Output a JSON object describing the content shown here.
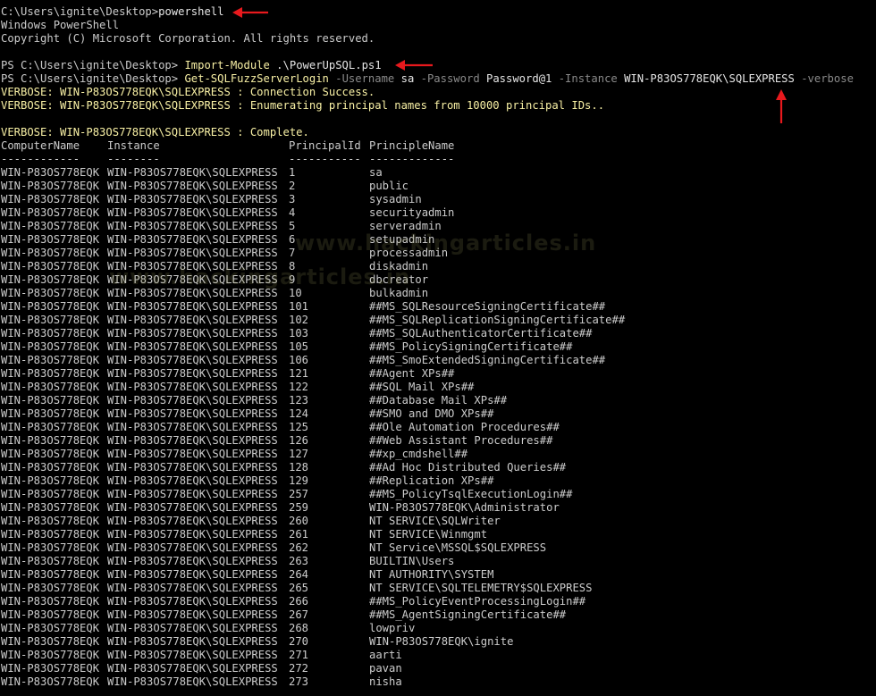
{
  "terminal": {
    "line1_prompt": "C:\\Users\\ignite\\Desktop>",
    "line1_cmd": "powershell",
    "line2": "Windows PowerShell",
    "line3": "Copyright (C) Microsoft Corporation. All rights reserved.",
    "line5_prompt": "PS C:\\Users\\ignite\\Desktop> ",
    "line5_cmd": "Import-Module",
    "line5_arg": " .\\PowerUpSQL.ps1",
    "line6_prompt": "PS C:\\Users\\ignite\\Desktop> ",
    "line6_cmd": "Get-SQLFuzzServerLogin",
    "line6_p1": " -Username",
    "line6_v1": " sa",
    "line6_p2": " -Password",
    "line6_v2": " Password@1",
    "line6_p3": " -Instance",
    "line6_v3": " WIN-P83OS778EQK\\SQLEXPRESS",
    "line6_p4": " -verbose",
    "verbose1": "VERBOSE: WIN-P83OS778EQK\\SQLEXPRESS : Connection Success.",
    "verbose2": "VERBOSE: WIN-P83OS778EQK\\SQLEXPRESS : Enumerating principal names from 10000 principal IDs..",
    "verbose3": "VERBOSE: WIN-P83OS778EQK\\SQLEXPRESS : Complete."
  },
  "table": {
    "headers": [
      "ComputerName",
      "Instance",
      "PrincipalId",
      "PrincipleName"
    ],
    "separators": [
      "------------",
      "--------",
      "-----------",
      "-------------"
    ],
    "computer": "WIN-P83OS778EQK",
    "instance": "WIN-P83OS778EQK\\SQLEXPRESS",
    "rows": [
      [
        "1",
        "sa"
      ],
      [
        "2",
        "public"
      ],
      [
        "3",
        "sysadmin"
      ],
      [
        "4",
        "securityadmin"
      ],
      [
        "5",
        "serveradmin"
      ],
      [
        "6",
        "setupadmin"
      ],
      [
        "7",
        "processadmin"
      ],
      [
        "8",
        "diskadmin"
      ],
      [
        "9",
        "dbcreator"
      ],
      [
        "10",
        "bulkadmin"
      ],
      [
        "101",
        "##MS_SQLResourceSigningCertificate##"
      ],
      [
        "102",
        "##MS_SQLReplicationSigningCertificate##"
      ],
      [
        "103",
        "##MS_SQLAuthenticatorCertificate##"
      ],
      [
        "105",
        "##MS_PolicySigningCertificate##"
      ],
      [
        "106",
        "##MS_SmoExtendedSigningCertificate##"
      ],
      [
        "121",
        "##Agent XPs##"
      ],
      [
        "122",
        "##SQL Mail XPs##"
      ],
      [
        "123",
        "##Database Mail XPs##"
      ],
      [
        "124",
        "##SMO and DMO XPs##"
      ],
      [
        "125",
        "##Ole Automation Procedures##"
      ],
      [
        "126",
        "##Web Assistant Procedures##"
      ],
      [
        "127",
        "##xp_cmdshell##"
      ],
      [
        "128",
        "##Ad Hoc Distributed Queries##"
      ],
      [
        "129",
        "##Replication XPs##"
      ],
      [
        "257",
        "##MS_PolicyTsqlExecutionLogin##"
      ],
      [
        "259",
        "WIN-P83OS778EQK\\Administrator"
      ],
      [
        "260",
        "NT SERVICE\\SQLWriter"
      ],
      [
        "261",
        "NT SERVICE\\Winmgmt"
      ],
      [
        "262",
        "NT Service\\MSSQL$SQLEXPRESS"
      ],
      [
        "263",
        "BUILTIN\\Users"
      ],
      [
        "264",
        "NT AUTHORITY\\SYSTEM"
      ],
      [
        "265",
        "NT SERVICE\\SQLTELEMETRY$SQLEXPRESS"
      ],
      [
        "266",
        "##MS_PolicyEventProcessingLogin##"
      ],
      [
        "267",
        "##MS_AgentSigningCertificate##"
      ],
      [
        "268",
        "lowpriv"
      ],
      [
        "270",
        "WIN-P83OS778EQK\\ignite"
      ],
      [
        "271",
        "aarti"
      ],
      [
        "272",
        "pavan"
      ],
      [
        "273",
        "nisha"
      ]
    ]
  },
  "watermarks": [
    "www.hackingarticles.in",
    "www.hackingarticles.in"
  ],
  "colors": {
    "background": "#000000",
    "text": "#cccccc",
    "command": "#f9f1a5",
    "parameter": "#8a8a8a",
    "arrow": "#e8191d"
  }
}
